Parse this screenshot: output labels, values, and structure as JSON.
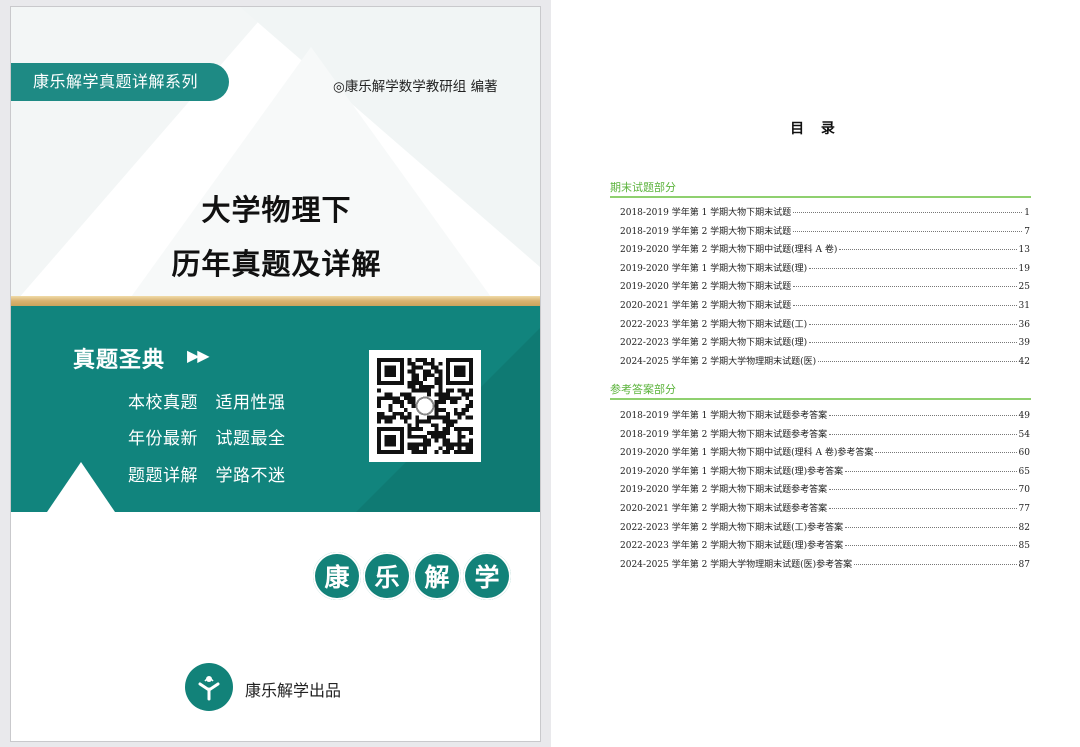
{
  "cover": {
    "series": "康乐解学真题详解系列",
    "author": "◎康乐解学数学教研组 编著",
    "title_line1": "大学物理下",
    "title_line2": "历年真题及详解",
    "slogan": "真题圣典",
    "slogan_arrows": "▶▶",
    "features": [
      "本校真题　适用性强",
      "年份最新　试题最全",
      "题题详解　学路不迷"
    ],
    "brand_chars": [
      "康",
      "乐",
      "解",
      "学"
    ],
    "publisher": "康乐解学出品",
    "colors": {
      "teal": "#11847d",
      "gold": "#d8b270",
      "green_heading": "#5bb33b"
    }
  },
  "toc": {
    "title": "目 录",
    "sections": [
      {
        "heading": "期末试题部分",
        "entries": [
          {
            "label": "2018-2019 学年第 1 学期大物下期末试题",
            "page": "1"
          },
          {
            "label": "2018-2019 学年第 2 学期大物下期末试题",
            "page": "7"
          },
          {
            "label": "2019-2020 学年第 2 学期大物下期中试题(理科 A 卷)",
            "page": "13"
          },
          {
            "label": "2019-2020 学年第 1 学期大物下期末试题(理)",
            "page": "19"
          },
          {
            "label": "2019-2020 学年第 2 学期大物下期末试题",
            "page": "25"
          },
          {
            "label": "2020-2021 学年第 2 学期大物下期末试题",
            "page": "31"
          },
          {
            "label": "2022-2023 学年第 2 学期大物下期末试题(工)",
            "page": "36"
          },
          {
            "label": "2022-2023 学年第 2 学期大物下期末试题(理)",
            "page": "39"
          },
          {
            "label": "2024-2025 学年第 2 学期大学物理期末试题(医)",
            "page": "42"
          }
        ]
      },
      {
        "heading": "参考答案部分",
        "entries": [
          {
            "label": "2018-2019 学年第 1 学期大物下期末试题参考答案",
            "page": "49"
          },
          {
            "label": "2018-2019 学年第 2 学期大物下期末试题参考答案",
            "page": "54"
          },
          {
            "label": "2019-2020 学年第 1 学期大物下期中试题(理科 A 卷)参考答案",
            "page": "60"
          },
          {
            "label": "2019-2020 学年第 1 学期大物下期末试题(理)参考答案",
            "page": "65"
          },
          {
            "label": "2019-2020 学年第 2 学期大物下期末试题参考答案",
            "page": "70"
          },
          {
            "label": "2020-2021 学年第 2 学期大物下期末试题参考答案",
            "page": "77"
          },
          {
            "label": "2022-2023 学年第 2 学期大物下期末试题(工)参考答案",
            "page": "82"
          },
          {
            "label": "2022-2023 学年第 2 学期大物下期末试题(理)参考答案",
            "page": "85"
          },
          {
            "label": "2024-2025 学年第 2 学期大学物理期末试题(医)参考答案",
            "page": "87"
          }
        ]
      }
    ]
  }
}
